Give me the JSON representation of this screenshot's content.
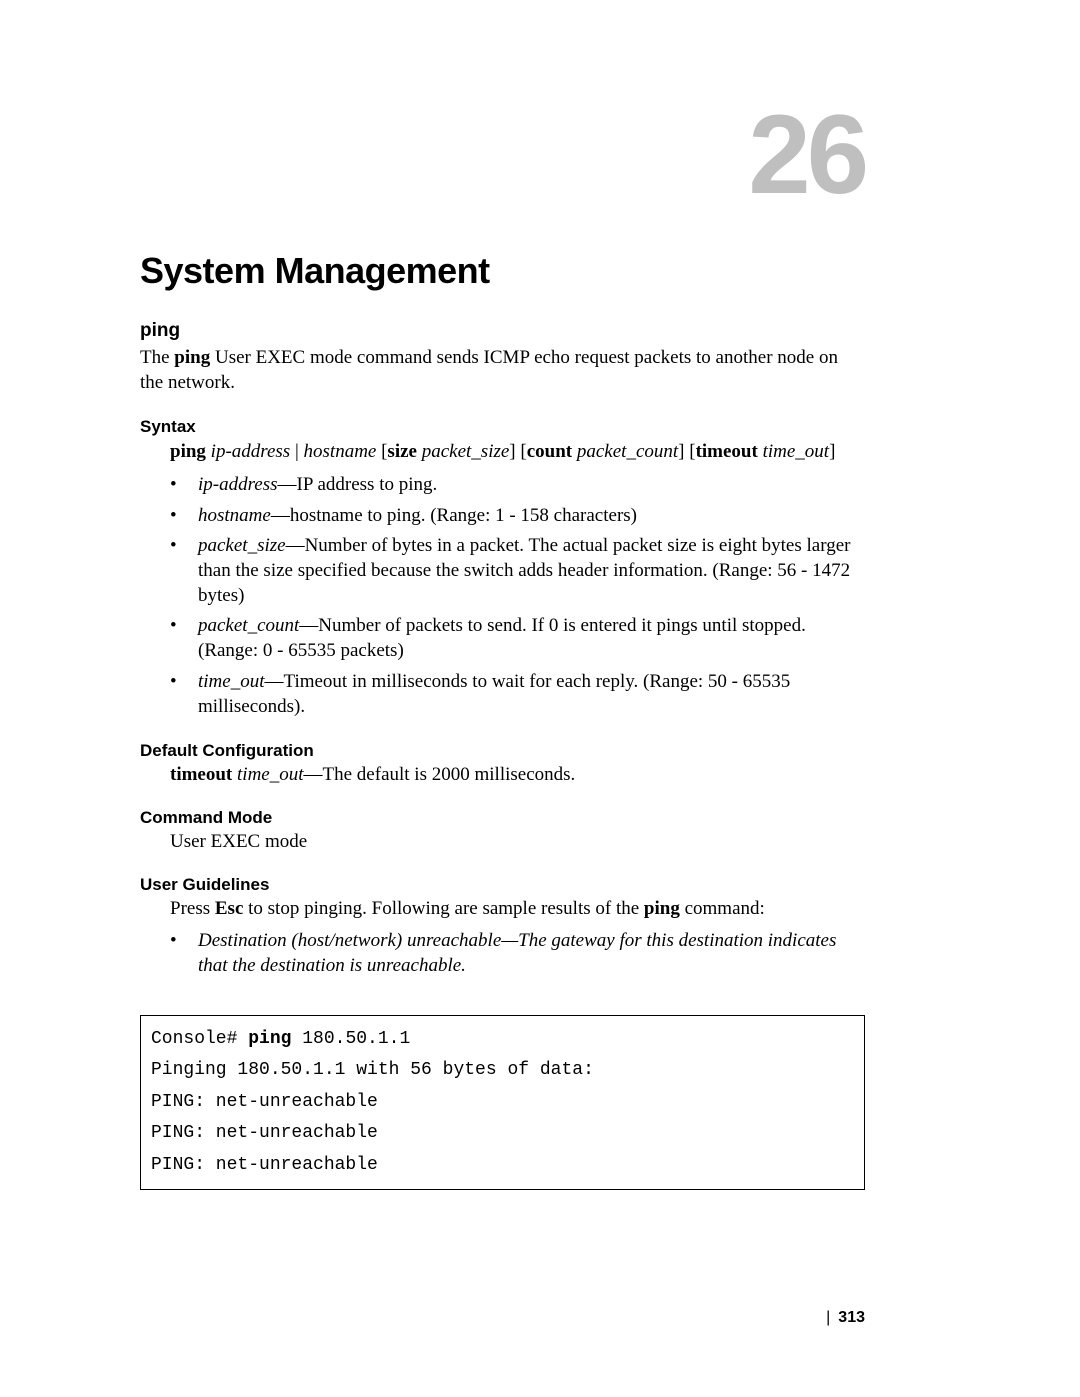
{
  "chapter": {
    "number": "26",
    "title": "System Management"
  },
  "command": {
    "name": "ping",
    "description_pre": "The ",
    "description_cmd": "ping",
    "description_post": " User EXEC mode command sends ICMP echo request packets to another node on the network."
  },
  "syntax": {
    "heading": "Syntax",
    "line": {
      "t1": "ping ",
      "t2": "ip-address",
      "t3": " | ",
      "t4": "hostname",
      "t5": " [",
      "t6": "size",
      "t7": " ",
      "t8": "packet_size",
      "t9": "] [",
      "t10": "count",
      "t11": " ",
      "t12": "packet_count",
      "t13": "] [",
      "t14": "timeout",
      "t15": " ",
      "t16": "time_out",
      "t17": "]"
    },
    "params": [
      {
        "name": "ip-address",
        "desc": "—IP address to ping."
      },
      {
        "name": "hostname",
        "desc": "—hostname to ping. (Range: 1 - 158 characters)"
      },
      {
        "name": "packet_size",
        "desc": "—Number of bytes in a packet. The actual packet size is eight bytes larger than the size specified because the switch adds header information. (Range: 56 - 1472 bytes)"
      },
      {
        "name": "packet_count",
        "desc": "—Number of packets to send. If 0 is entered it pings until stopped. (Range: 0 - 65535 packets)"
      },
      {
        "name": "time_out",
        "desc": "—Timeout in milliseconds to wait for each reply. (Range: 50 - 65535 milliseconds)."
      }
    ]
  },
  "default_config": {
    "heading": "Default Configuration",
    "t1": "timeout",
    "t2": " ",
    "t3": "time_out",
    "t4": "—The default is 2000 milliseconds."
  },
  "command_mode": {
    "heading": "Command Mode",
    "text": "User EXEC mode"
  },
  "user_guidelines": {
    "heading": "User Guidelines",
    "line": {
      "a": "Press ",
      "b": "Esc",
      "c": " to stop pinging. Following are sample results of the ",
      "d": "ping",
      "e": " command:"
    },
    "bullet": {
      "a": "Destination (host/network) unreachable—The gateway for this destination indicates that the destination is unreachable."
    }
  },
  "console": {
    "prompt": "Console# ",
    "cmd_bold": "ping",
    "cmd_rest": " 180.50.1.1",
    "l2": "Pinging 180.50.1.1 with 56 bytes of data:",
    "l3": "PING: net-unreachable",
    "l4": "PING: net-unreachable",
    "l5": "PING: net-unreachable"
  },
  "footer": {
    "divider": "|",
    "page": "313"
  }
}
